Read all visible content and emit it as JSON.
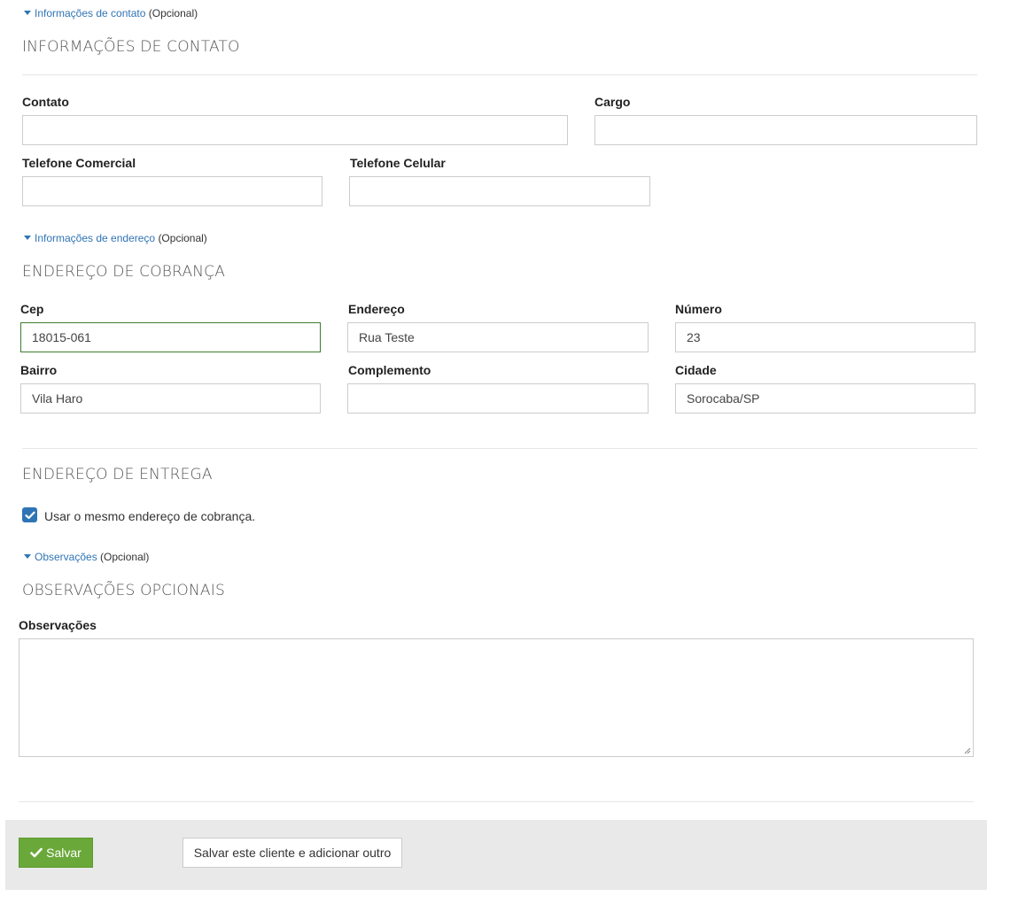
{
  "contact_toggle": {
    "link": "Informações de contato",
    "suffix": "(Opcional)"
  },
  "contact_section": {
    "title": "INFORMAÇÕES DE CONTATO",
    "contato_label": "Contato",
    "cargo_label": "Cargo",
    "telefone_comercial_label": "Telefone Comercial",
    "telefone_celular_label": "Telefone Celular"
  },
  "address_toggle": {
    "link": "Informações de endereço",
    "suffix": "(Opcional)"
  },
  "billing_section": {
    "title": "ENDEREÇO DE COBRANÇA",
    "cep_label": "Cep",
    "cep_value": "18015-061",
    "endereco_label": "Endereço",
    "endereco_value": "Rua Teste",
    "numero_label": "Número",
    "numero_value": "23",
    "bairro_label": "Bairro",
    "bairro_value": "Vila Haro",
    "complemento_label": "Complemento",
    "cidade_label": "Cidade",
    "cidade_value": "Sorocaba/SP"
  },
  "delivery_section": {
    "title": "ENDEREÇO DE ENTREGA",
    "same_address_label": "Usar o mesmo endereço de cobrança.",
    "same_address_checked": true
  },
  "notes_toggle": {
    "link": "Observações",
    "suffix": "(Opcional)"
  },
  "notes_section": {
    "title": "OBSERVAÇÕES OPCIONAIS",
    "observacoes_label": "Observações"
  },
  "footer": {
    "save_label": "Salvar",
    "save_and_add_label": "Salvar este cliente e adicionar outro"
  },
  "colors": {
    "link": "#2f74b5",
    "primary_button": "#6aa83a",
    "checkbox": "#2f74b5",
    "focused_border": "#3c7d2e"
  },
  "icons": {
    "toggle": "caret-down-icon",
    "save": "check-icon",
    "checkbox": "checkmark-icon"
  }
}
